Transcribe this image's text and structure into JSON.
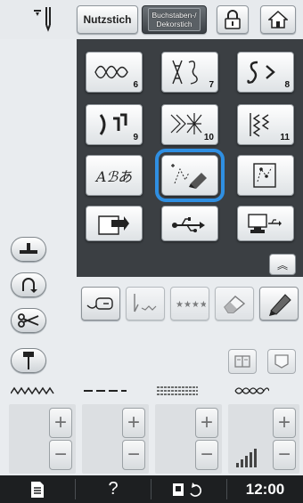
{
  "topbar": {
    "needle_icon": "needle-position-icon",
    "utility_stitch_label": "Nutzstich",
    "character_stitch_label": "Buchstaben-/\nDekorstich",
    "lock_icon": "lock-icon",
    "home_icon": "home-icon"
  },
  "grid": {
    "items": [
      {
        "name": "decorative-stitch-6",
        "number": "6"
      },
      {
        "name": "decorative-stitch-7",
        "number": "7"
      },
      {
        "name": "decorative-stitch-8",
        "number": "8"
      },
      {
        "name": "decorative-stitch-9",
        "number": "9"
      },
      {
        "name": "decorative-stitch-10",
        "number": "10"
      },
      {
        "name": "decorative-stitch-11",
        "number": "11"
      },
      {
        "name": "character-stitch",
        "text": "Aℬあ"
      },
      {
        "name": "my-custom-stitch",
        "selected": true
      },
      {
        "name": "stitch-editor"
      },
      {
        "name": "retrieve-memory"
      },
      {
        "name": "usb-media"
      },
      {
        "name": "computer-usb"
      }
    ],
    "scroll_up_icon": "chevron-up-icon",
    "highlight_color": "#2f8fe2"
  },
  "toolbar": {
    "icons": [
      "thread-cutter-icon",
      "character-spacing-icon",
      "multi-color-icon",
      "eraser-icon",
      "pen-icon"
    ]
  },
  "left_controls": [
    "presser-foot-icon",
    "reverse-stitch-icon",
    "scissors-icon",
    "needle-down-icon"
  ],
  "adjusters": [
    "stitch-width",
    "stitch-length",
    "stitch-density",
    "tension"
  ],
  "statusbar": {
    "clock": "12:00",
    "help": "?"
  }
}
